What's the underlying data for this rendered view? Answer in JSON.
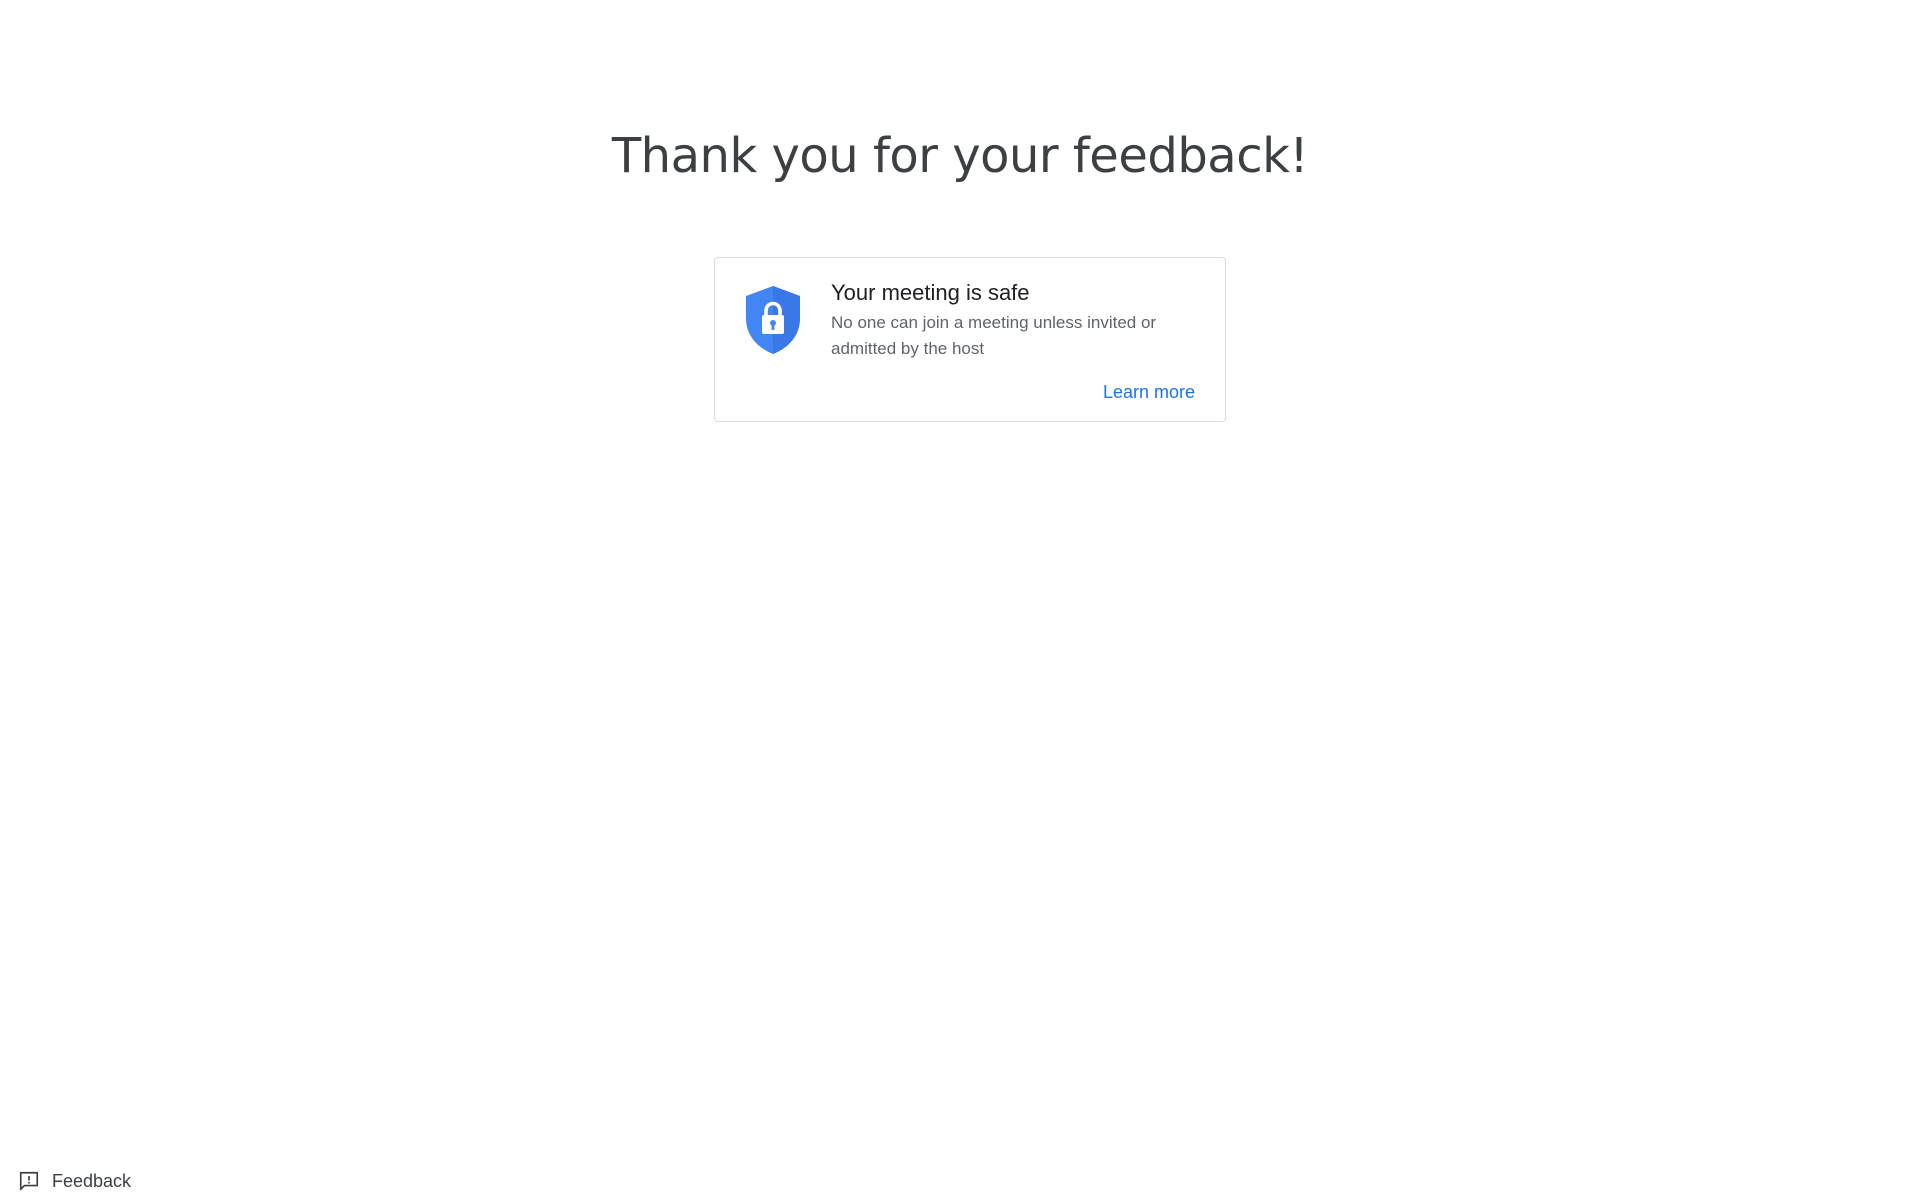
{
  "main": {
    "heading": "Thank you for your feedback!"
  },
  "safety_card": {
    "icon": "shield-lock-icon",
    "title": "Your meeting is safe",
    "body": "No one can join a meeting unless invited or admitted by the host",
    "link_label": "Learn more"
  },
  "footer": {
    "feedback_icon": "feedback-icon",
    "feedback_label": "Feedback"
  },
  "colors": {
    "accent": "#1a73e8",
    "shield": "#4285f4",
    "heading_text": "#3c4043",
    "body_text": "#5f6368",
    "card_border": "#dadce0"
  }
}
